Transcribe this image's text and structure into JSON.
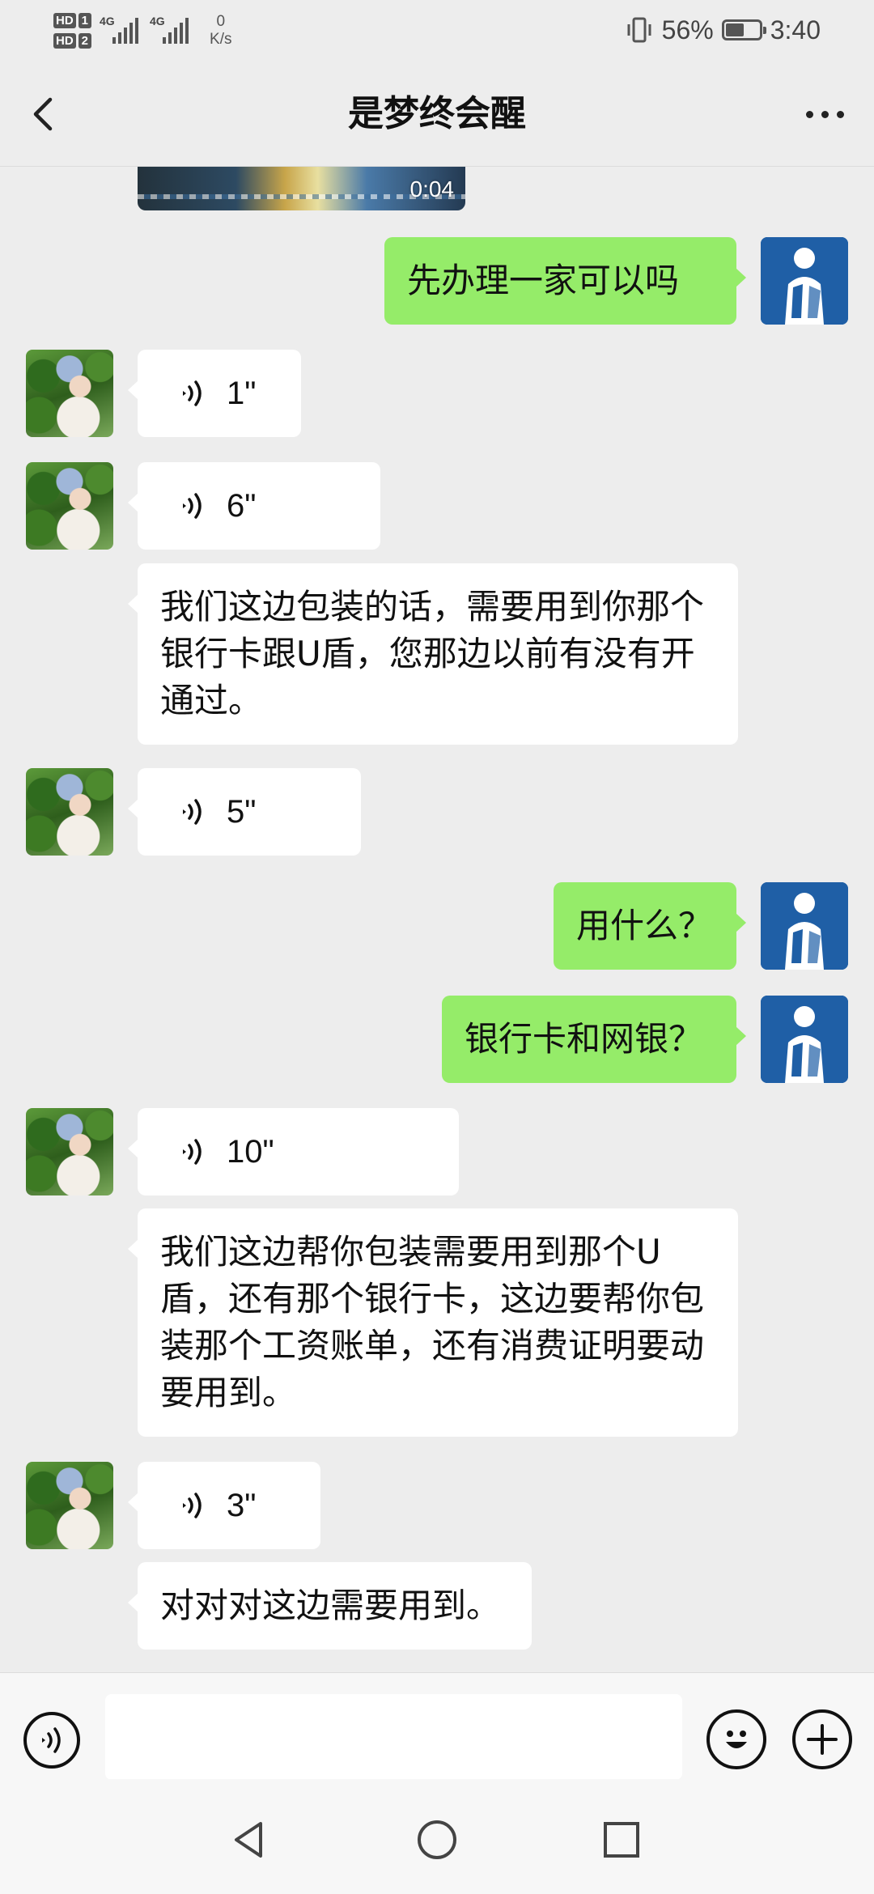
{
  "status_bar": {
    "hd1": "HD",
    "sim1": "1",
    "hd2": "HD",
    "sim2": "2",
    "network1": "4G",
    "network2": "4G",
    "speed_value": "0",
    "speed_unit": "K/s",
    "battery_percent": "56%",
    "battery_level": 0.56,
    "time": "3:40"
  },
  "header": {
    "title": "是梦终会醒",
    "back_icon": "chevron-left-icon",
    "more_icon": "more-dots-icon"
  },
  "messages": {
    "video_duration": "0:04",
    "m1_text": "先办理一家可以吗",
    "m2_duration": "1\"",
    "m3_duration": "6\"",
    "m4_text": "我们这边包装的话，需要用到你那个银行卡跟U盾，您那边以前有没有开通过。",
    "m5_duration": "5\"",
    "m6_text": "用什么？",
    "m7_text": "银行卡和网银？",
    "m8_duration": "10\"",
    "m9_text": "我们这边帮你包装需要用到那个U盾，还有那个银行卡，这边要帮你包装那个工资账单，还有消费证明要动要用到。",
    "m10_duration": "3\"",
    "m11_text": "对对对这边需要用到。"
  },
  "input_bar": {
    "voice_icon": "voice-input-icon",
    "input_value": "",
    "emoji_icon": "emoji-icon",
    "plus_icon": "plus-icon"
  },
  "system_nav": {
    "back": "nav-back-triangle-icon",
    "home": "nav-home-circle-icon",
    "recents": "nav-recents-square-icon"
  },
  "colors": {
    "background": "#ededed",
    "outgoing_bubble": "#95ec69",
    "incoming_bubble": "#ffffff"
  }
}
